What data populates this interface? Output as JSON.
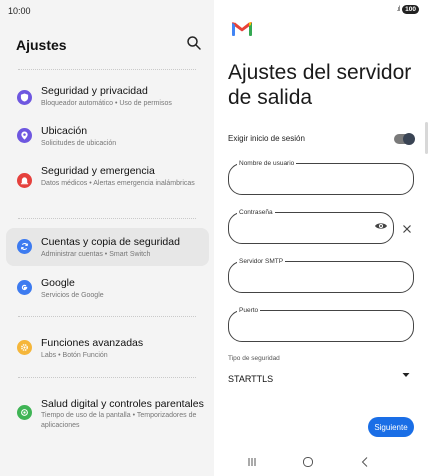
{
  "status": {
    "time": "10:00",
    "signal": ".ıl",
    "battery": "100"
  },
  "settings": {
    "title": "Ajustes",
    "items": [
      {
        "title": "Seguridad y privacidad",
        "subtitle": "Bloqueador automático • Uso de permisos",
        "color": "#6e57e0",
        "icon": "shield-icon"
      },
      {
        "title": "Ubicación",
        "subtitle": "Solicitudes de ubicación",
        "color": "#6e57e0",
        "icon": "location-pin-icon"
      },
      {
        "title": "Seguridad y emergencia",
        "subtitle": "Datos médicos • Alertas emergencia inalámbricas",
        "color": "#e5413d",
        "icon": "emergency-alert-icon"
      },
      {
        "title": "Cuentas y copia de seguridad",
        "subtitle": "Administrar cuentas • Smart Switch",
        "color": "#3d7bf0",
        "icon": "sync-icon"
      },
      {
        "title": "Google",
        "subtitle": "Servicios de Google",
        "color": "#3d7bf0",
        "icon": "google-icon"
      },
      {
        "title": "Funciones avanzadas",
        "subtitle": "Labs • Botón Función",
        "color": "#f5b63a",
        "icon": "gear-icon"
      },
      {
        "title": "Salud digital y controles parentales",
        "subtitle": "Tiempo de uso de la pantalla • Temporizadores de aplicaciones",
        "color": "#3fb455",
        "icon": "wellbeing-icon"
      }
    ]
  },
  "gmail": {
    "title": "Ajustes del servidor de salida",
    "require_login_label": "Exigir inicio de sesión",
    "require_login_on": true,
    "username_label": "Nombre de usuario",
    "username_value": "",
    "password_label": "Contraseña",
    "password_value": "",
    "smtp_label": "Servidor SMTP",
    "smtp_value": "",
    "port_label": "Puerto",
    "port_value": "",
    "security_label": "Tipo de seguridad",
    "security_value": "STARTTLS",
    "next_label": "Siguiente"
  },
  "colors": {
    "accent": "#1a6ee6",
    "toggle_knob": "#3a4454"
  }
}
